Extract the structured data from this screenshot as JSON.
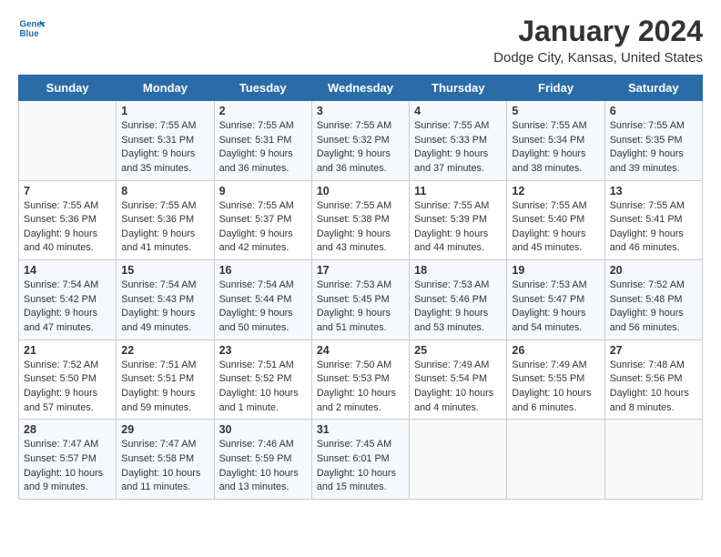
{
  "header": {
    "logo_line1": "General",
    "logo_line2": "Blue",
    "title": "January 2024",
    "subtitle": "Dodge City, Kansas, United States"
  },
  "weekdays": [
    "Sunday",
    "Monday",
    "Tuesday",
    "Wednesday",
    "Thursday",
    "Friday",
    "Saturday"
  ],
  "weeks": [
    [
      {
        "day": "",
        "info": ""
      },
      {
        "day": "1",
        "info": "Sunrise: 7:55 AM\nSunset: 5:31 PM\nDaylight: 9 hours\nand 35 minutes."
      },
      {
        "day": "2",
        "info": "Sunrise: 7:55 AM\nSunset: 5:31 PM\nDaylight: 9 hours\nand 36 minutes."
      },
      {
        "day": "3",
        "info": "Sunrise: 7:55 AM\nSunset: 5:32 PM\nDaylight: 9 hours\nand 36 minutes."
      },
      {
        "day": "4",
        "info": "Sunrise: 7:55 AM\nSunset: 5:33 PM\nDaylight: 9 hours\nand 37 minutes."
      },
      {
        "day": "5",
        "info": "Sunrise: 7:55 AM\nSunset: 5:34 PM\nDaylight: 9 hours\nand 38 minutes."
      },
      {
        "day": "6",
        "info": "Sunrise: 7:55 AM\nSunset: 5:35 PM\nDaylight: 9 hours\nand 39 minutes."
      }
    ],
    [
      {
        "day": "7",
        "info": "Sunrise: 7:55 AM\nSunset: 5:36 PM\nDaylight: 9 hours\nand 40 minutes."
      },
      {
        "day": "8",
        "info": "Sunrise: 7:55 AM\nSunset: 5:36 PM\nDaylight: 9 hours\nand 41 minutes."
      },
      {
        "day": "9",
        "info": "Sunrise: 7:55 AM\nSunset: 5:37 PM\nDaylight: 9 hours\nand 42 minutes."
      },
      {
        "day": "10",
        "info": "Sunrise: 7:55 AM\nSunset: 5:38 PM\nDaylight: 9 hours\nand 43 minutes."
      },
      {
        "day": "11",
        "info": "Sunrise: 7:55 AM\nSunset: 5:39 PM\nDaylight: 9 hours\nand 44 minutes."
      },
      {
        "day": "12",
        "info": "Sunrise: 7:55 AM\nSunset: 5:40 PM\nDaylight: 9 hours\nand 45 minutes."
      },
      {
        "day": "13",
        "info": "Sunrise: 7:55 AM\nSunset: 5:41 PM\nDaylight: 9 hours\nand 46 minutes."
      }
    ],
    [
      {
        "day": "14",
        "info": "Sunrise: 7:54 AM\nSunset: 5:42 PM\nDaylight: 9 hours\nand 47 minutes."
      },
      {
        "day": "15",
        "info": "Sunrise: 7:54 AM\nSunset: 5:43 PM\nDaylight: 9 hours\nand 49 minutes."
      },
      {
        "day": "16",
        "info": "Sunrise: 7:54 AM\nSunset: 5:44 PM\nDaylight: 9 hours\nand 50 minutes."
      },
      {
        "day": "17",
        "info": "Sunrise: 7:53 AM\nSunset: 5:45 PM\nDaylight: 9 hours\nand 51 minutes."
      },
      {
        "day": "18",
        "info": "Sunrise: 7:53 AM\nSunset: 5:46 PM\nDaylight: 9 hours\nand 53 minutes."
      },
      {
        "day": "19",
        "info": "Sunrise: 7:53 AM\nSunset: 5:47 PM\nDaylight: 9 hours\nand 54 minutes."
      },
      {
        "day": "20",
        "info": "Sunrise: 7:52 AM\nSunset: 5:48 PM\nDaylight: 9 hours\nand 56 minutes."
      }
    ],
    [
      {
        "day": "21",
        "info": "Sunrise: 7:52 AM\nSunset: 5:50 PM\nDaylight: 9 hours\nand 57 minutes."
      },
      {
        "day": "22",
        "info": "Sunrise: 7:51 AM\nSunset: 5:51 PM\nDaylight: 9 hours\nand 59 minutes."
      },
      {
        "day": "23",
        "info": "Sunrise: 7:51 AM\nSunset: 5:52 PM\nDaylight: 10 hours\nand 1 minute."
      },
      {
        "day": "24",
        "info": "Sunrise: 7:50 AM\nSunset: 5:53 PM\nDaylight: 10 hours\nand 2 minutes."
      },
      {
        "day": "25",
        "info": "Sunrise: 7:49 AM\nSunset: 5:54 PM\nDaylight: 10 hours\nand 4 minutes."
      },
      {
        "day": "26",
        "info": "Sunrise: 7:49 AM\nSunset: 5:55 PM\nDaylight: 10 hours\nand 6 minutes."
      },
      {
        "day": "27",
        "info": "Sunrise: 7:48 AM\nSunset: 5:56 PM\nDaylight: 10 hours\nand 8 minutes."
      }
    ],
    [
      {
        "day": "28",
        "info": "Sunrise: 7:47 AM\nSunset: 5:57 PM\nDaylight: 10 hours\nand 9 minutes."
      },
      {
        "day": "29",
        "info": "Sunrise: 7:47 AM\nSunset: 5:58 PM\nDaylight: 10 hours\nand 11 minutes."
      },
      {
        "day": "30",
        "info": "Sunrise: 7:46 AM\nSunset: 5:59 PM\nDaylight: 10 hours\nand 13 minutes."
      },
      {
        "day": "31",
        "info": "Sunrise: 7:45 AM\nSunset: 6:01 PM\nDaylight: 10 hours\nand 15 minutes."
      },
      {
        "day": "",
        "info": ""
      },
      {
        "day": "",
        "info": ""
      },
      {
        "day": "",
        "info": ""
      }
    ]
  ]
}
